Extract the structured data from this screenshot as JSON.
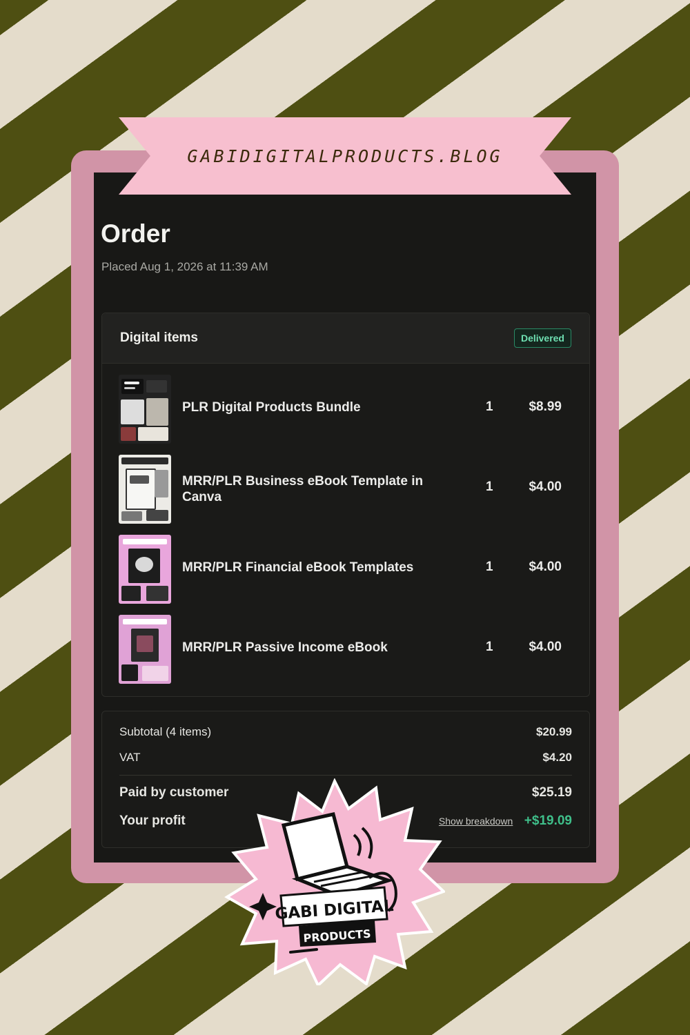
{
  "banner": {
    "text": "GABIDIGITALPRODUCTS.BLOG"
  },
  "order": {
    "title": "Order",
    "placed": "Placed Aug 1, 2026 at 11:39 AM"
  },
  "digital_items": {
    "heading": "Digital items",
    "status": "Delivered",
    "items": [
      {
        "name": "PLR Digital Products Bundle",
        "qty": "1",
        "price": "$8.99"
      },
      {
        "name": "MRR/PLR Business eBook Template in Canva",
        "qty": "1",
        "price": "$4.00"
      },
      {
        "name": "MRR/PLR Financial eBook Templates",
        "qty": "1",
        "price": "$4.00"
      },
      {
        "name": "MRR/PLR Passive Income eBook",
        "qty": "1",
        "price": "$4.00"
      }
    ]
  },
  "totals": {
    "subtotal_label": "Subtotal (4 items)",
    "subtotal_value": "$20.99",
    "vat_label": "VAT",
    "vat_value": "$4.20",
    "paid_label": "Paid by customer",
    "paid_value": "$25.19",
    "profit_label": "Your profit",
    "breakdown_link": "Show breakdown",
    "profit_value": "+$19.09"
  },
  "logo": {
    "line1": "GABI DIGITAL",
    "line2": "PRODUCTS"
  },
  "colors": {
    "stripe_dark": "#4e4f12",
    "stripe_light": "#e4dccb",
    "frame_pink": "#d194a7",
    "banner_pink": "#f7bfcf",
    "screen_bg": "#181816",
    "delivered_green": "#6fe0b2",
    "profit_green": "#3fbf8a"
  }
}
